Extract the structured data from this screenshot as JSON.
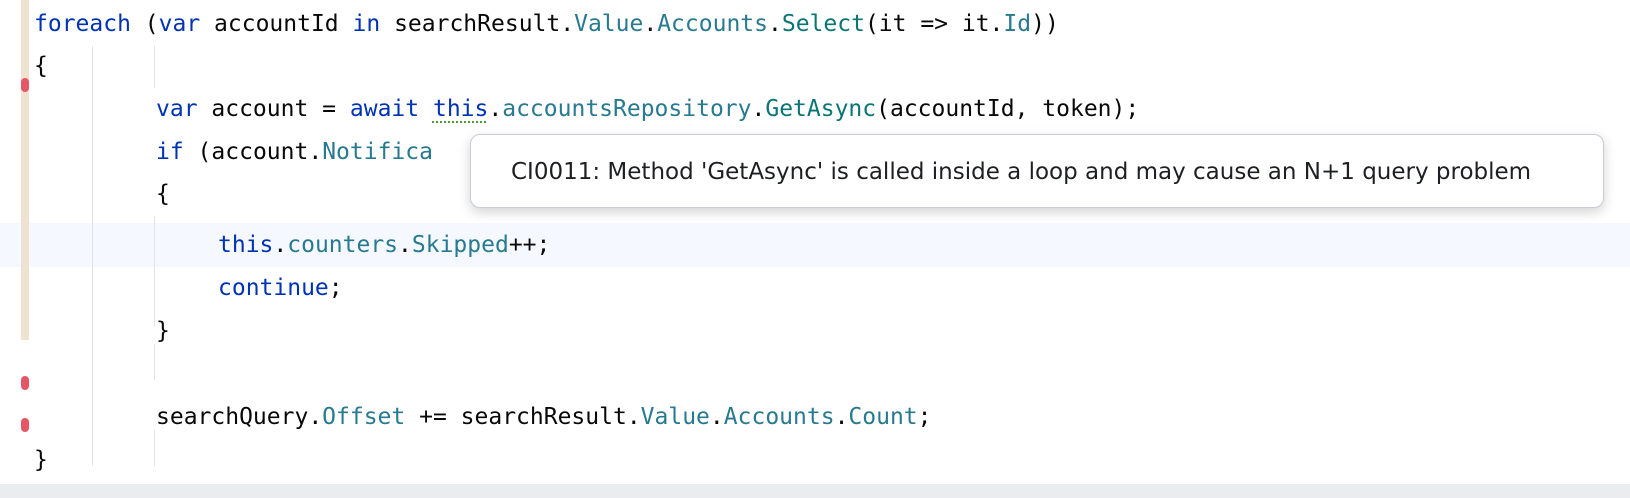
{
  "editor": {
    "line1": {
      "kw_foreach": "foreach",
      "t_open": " (",
      "kw_var": "var",
      "t_account_id": " accountId ",
      "kw_in": "in",
      "t_search_result": " searchResult.",
      "m_value": "Value",
      "t_dot1": ".",
      "m_accounts": "Accounts",
      "t_dot2": ".",
      "f_select": "Select",
      "t_lambda": "(it => it.",
      "m_id": "Id",
      "t_close": "))"
    },
    "line2": {
      "t_brace": "{"
    },
    "line3": {
      "kw_var": "var",
      "t_account_assign": " account = ",
      "kw_await": "await",
      "t_space": " ",
      "kw_this": "this",
      "t_dot": ".",
      "m_repo": "accountsRepository",
      "t_dot2": ".",
      "f_getasync": "GetAsync",
      "t_args": "(accountId, token);"
    },
    "line4": {
      "kw_if": "if",
      "t_open": " (account.",
      "m_partial": "Notifica"
    },
    "line5": {
      "t_brace": "{"
    },
    "line6": {
      "kw_this": "this",
      "t_dot": ".",
      "m_counters": "counters",
      "t_dot2": ".",
      "m_skipped": "Skipped",
      "t_inc": "++;"
    },
    "line7": {
      "kw_continue": "continue",
      "t_semi": ";"
    },
    "line8": {
      "t_brace": "}"
    },
    "line10": {
      "t_search_query": "searchQuery.",
      "m_offset": "Offset",
      "t_plus_assign": " += searchResult.",
      "m_value": "Value",
      "t_dot1": ".",
      "m_accounts": "Accounts",
      "t_dot2": ".",
      "m_count": "Count",
      "t_semi": ";"
    },
    "line11": {
      "t_brace": "}"
    }
  },
  "tooltip": {
    "text": "CI0011: Method 'GetAsync' is called inside a loop and may cause an N+1 query problem"
  },
  "colors": {
    "keyword": "#0033b3",
    "member": "#277a8f",
    "method": "#0b7575",
    "text": "#080808",
    "error_marker": "#e55765",
    "change_stripe": "#efe2d0",
    "current_line": "#f5f8fe"
  }
}
